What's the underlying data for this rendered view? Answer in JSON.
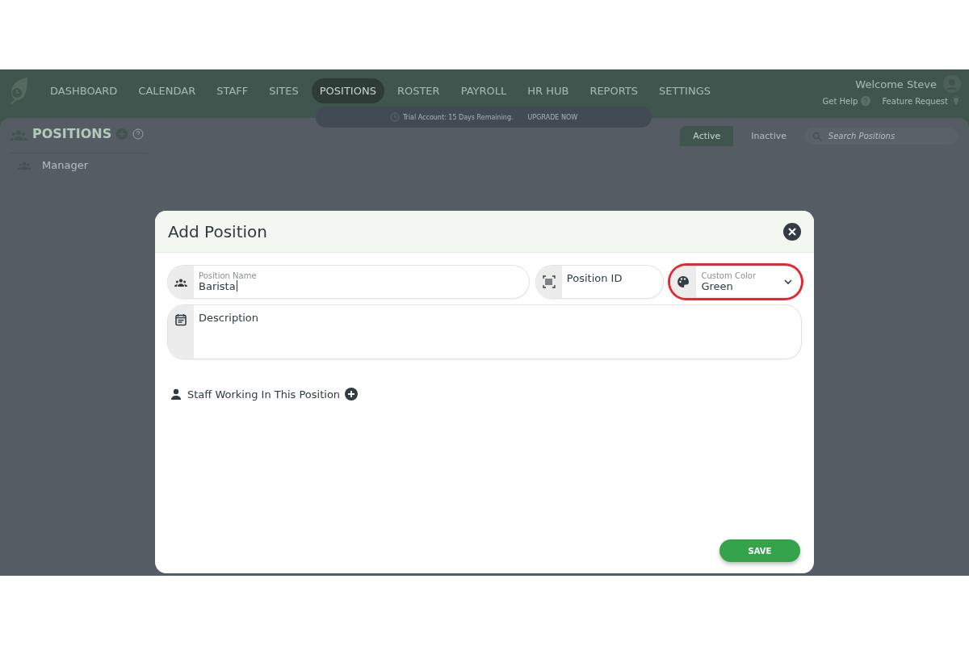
{
  "nav": {
    "items": [
      {
        "label": "DASHBOARD",
        "selected": false
      },
      {
        "label": "CALENDAR",
        "selected": false
      },
      {
        "label": "STAFF",
        "selected": false
      },
      {
        "label": "SITES",
        "selected": false
      },
      {
        "label": "POSITIONS",
        "selected": true
      },
      {
        "label": "ROSTER",
        "selected": false
      },
      {
        "label": "PAYROLL",
        "selected": false
      },
      {
        "label": "HR HUB",
        "selected": false
      },
      {
        "label": "REPORTS",
        "selected": false
      },
      {
        "label": "SETTINGS",
        "selected": false
      }
    ],
    "welcome": "Welcome Steve",
    "help": "Get Help",
    "feature": "Feature Request"
  },
  "trial": {
    "text": "Trial Account: 15 Days Remaining.",
    "action": "UPGRADE NOW"
  },
  "page": {
    "title": "POSITIONS",
    "tabs": [
      {
        "label": "Active",
        "selected": true
      },
      {
        "label": "Inactive",
        "selected": false
      }
    ],
    "search": {
      "placeholder": "Search Positions"
    },
    "items": [
      "Manager"
    ]
  },
  "modal": {
    "title": "Add Position",
    "position_name": {
      "label": "Position Name",
      "value": "Barista"
    },
    "position_id": {
      "placeholder": "Position ID"
    },
    "custom_color": {
      "label": "Custom Color",
      "value": "Green",
      "highlighted": true
    },
    "description": {
      "placeholder": "Description"
    },
    "staff_label": "Staff Working In This Position",
    "save": "SAVE"
  }
}
